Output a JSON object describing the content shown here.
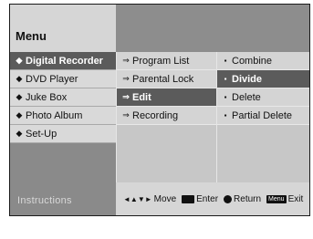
{
  "header": {
    "title": "Menu"
  },
  "main_menu": [
    {
      "label": "Digital Recorder",
      "icon": "disc-icon",
      "selected": true
    },
    {
      "label": "DVD Player",
      "icon": "disc-icon",
      "selected": false
    },
    {
      "label": "Juke Box",
      "icon": "disc-icon",
      "selected": false
    },
    {
      "label": "Photo Album",
      "icon": "disc-icon",
      "selected": false
    },
    {
      "label": "Set-Up",
      "icon": "disc-icon",
      "selected": false
    }
  ],
  "submenu": [
    {
      "label": "Program List",
      "selected": false
    },
    {
      "label": "Parental Lock",
      "selected": false
    },
    {
      "label": "Edit",
      "selected": true
    },
    {
      "label": "Recording",
      "selected": false
    }
  ],
  "edit_options": [
    {
      "label": "Combine",
      "selected": false
    },
    {
      "label": "Divide",
      "selected": true
    },
    {
      "label": "Delete",
      "selected": false
    },
    {
      "label": "Partial Delete",
      "selected": false
    }
  ],
  "footer": {
    "instructions_label": "Instructions",
    "move_icon": "◄▲▼►",
    "move_label": "Move",
    "enter_label": "Enter",
    "return_label": "Return",
    "exit_key_label": "Menu",
    "exit_label": "Exit"
  },
  "colors": {
    "selected_bg": "#5b5b5b",
    "panel_bg": "#8d8d8d",
    "item_bg": "#d4d4d4"
  }
}
